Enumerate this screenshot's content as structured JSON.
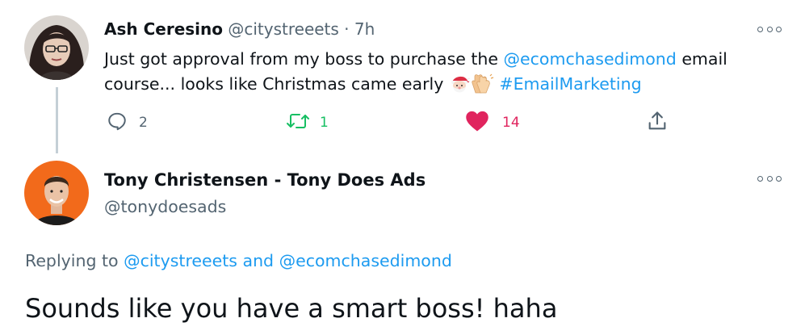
{
  "tweet": {
    "author_name": "Ash Ceresino",
    "author_handle": "@citystreeets",
    "separator": "·",
    "time": "7h",
    "text_part1": "Just got approval from my boss to purchase the ",
    "mention": "@ecomchasedimond",
    "text_part2": " email course... looks like Christmas came early ",
    "hashtag": "#EmailMarketing",
    "emojis": [
      "santa-emoji",
      "clapping-hands-emoji"
    ],
    "actions": {
      "reply_count": "2",
      "retweet_count": "1",
      "like_count": "14"
    },
    "colors": {
      "retweet": "#17bf63",
      "like": "#e0245e",
      "link": "#1d9bf0"
    }
  },
  "reply": {
    "author_name": "Tony Christensen - Tony Does Ads",
    "author_handle": "@tonydoesads",
    "replying_prefix": "Replying to ",
    "replying_user1": "@citystreeets",
    "replying_and": " and ",
    "replying_user2": "@ecomchasedimond",
    "text": "Sounds like you have a smart boss! haha"
  },
  "icons": [
    "more-options-icon",
    "reply-icon",
    "retweet-icon",
    "like-icon",
    "share-icon"
  ]
}
